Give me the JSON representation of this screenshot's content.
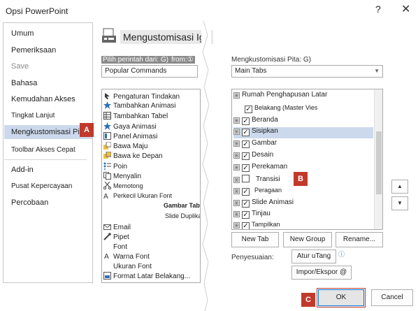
{
  "window": {
    "title": "Opsi PowerPoint",
    "help_glyph": "?",
    "close_glyph": "✕"
  },
  "nav": {
    "items": [
      {
        "label": "Umum"
      },
      {
        "label": "Pemeriksaan"
      },
      {
        "label": "Save"
      },
      {
        "label": "Bahasa"
      },
      {
        "label": "Kemudahan Akses"
      },
      {
        "label": "Tingkat Lanjut"
      },
      {
        "label": "Mengkustomisasi Pita"
      },
      {
        "label": "Toolbar Akses Cepat"
      },
      {
        "label": "Add-in"
      },
      {
        "label": "Pusat Kepercayaan"
      },
      {
        "label": "Percobaan"
      }
    ]
  },
  "callouts": {
    "a": "A",
    "b": "B",
    "c": "C"
  },
  "header": {
    "title": "Mengustomisasi Iga",
    "icon": "ribbon-customize-icon"
  },
  "left_panel": {
    "choose_label": "Pilih perintah dari: G)",
    "choose_label_extra": "from:①",
    "choose_value": "Popular Commands",
    "commands": [
      {
        "label": "Pengaturan Tindakan",
        "icon": "action-icon"
      },
      {
        "label": "Tambahkan Animasi",
        "icon": "star-icon"
      },
      {
        "label": "Tambahkan Tabel",
        "icon": "table-icon"
      },
      {
        "label": "Gaya Animasi",
        "icon": "star-icon"
      },
      {
        "label": "Panel Animasi",
        "icon": "panel-icon"
      },
      {
        "label": "Bawa Maju",
        "icon": "bring-forward-icon"
      },
      {
        "label": "Bawa ke Depan",
        "icon": "bring-front-icon"
      },
      {
        "label": "Poin",
        "icon": "bullets-icon"
      },
      {
        "label": "Menyalin",
        "icon": "copy-icon"
      },
      {
        "label": "Memotong",
        "icon": "cut-icon"
      },
      {
        "label": "Perkecil Ukuran Font",
        "icon": "font-decrease-icon"
      },
      {
        "label": "Gambar Tabel",
        "icon": ""
      },
      {
        "label": "Slide Duplikat",
        "icon": ""
      },
      {
        "label": "Email",
        "icon": "email-icon"
      },
      {
        "label": "Pipet",
        "icon": "eyedropper-icon"
      },
      {
        "label": "Font",
        "icon": ""
      },
      {
        "label": "Warna Font",
        "icon": "font-color-icon"
      },
      {
        "label": "Ukuran Font",
        "icon": ""
      },
      {
        "label": "Format Latar Belakang...",
        "icon": "format-bg-icon"
      }
    ]
  },
  "right_panel": {
    "customize_label": "Mengkustomisasi Pita: G)",
    "customize_value": "Main Tabs",
    "tabs": [
      {
        "label": "Rumah Penghapusan Latar",
        "checked": false,
        "expander": "⊞"
      },
      {
        "label": "Belakang (Master Vies",
        "checked": true,
        "expander": "⊞"
      },
      {
        "label": "Beranda",
        "checked": true,
        "expander": "⊞"
      },
      {
        "label": "Sisipkan",
        "checked": true,
        "expander": "⊞"
      },
      {
        "label": "Gambar",
        "checked": true,
        "expander": "⊞"
      },
      {
        "label": "Desain",
        "checked": true,
        "expander": "⊞"
      },
      {
        "label": "Perekaman",
        "checked": true,
        "expander": "⊞"
      },
      {
        "label": "Transisi",
        "checked": false,
        "expander": "⊞"
      },
      {
        "label": "Peragaan",
        "checked": true,
        "expander": "⊞"
      },
      {
        "label": "Slide Animasi",
        "checked": true,
        "expander": "⊞"
      },
      {
        "label": "Tinjau",
        "checked": true,
        "expander": "⊞"
      },
      {
        "label": "Tampilkan",
        "checked": true,
        "expander": "⊞"
      }
    ],
    "new_tab": "New Tab",
    "new_group": "New Group",
    "rename": "Rename...",
    "customizations_label": "Penyesuaian:",
    "reset_label": "Atur uTang",
    "import_export_label": "Impor/Ekspor @"
  },
  "move_up_glyph": "▲",
  "move_down_glyph": "▼",
  "footer": {
    "ok": "OK",
    "cancel": "Cancel"
  },
  "colors": {
    "callout": "#c0392b",
    "selection": "#ccd9ec",
    "focus": "#0078d7"
  }
}
